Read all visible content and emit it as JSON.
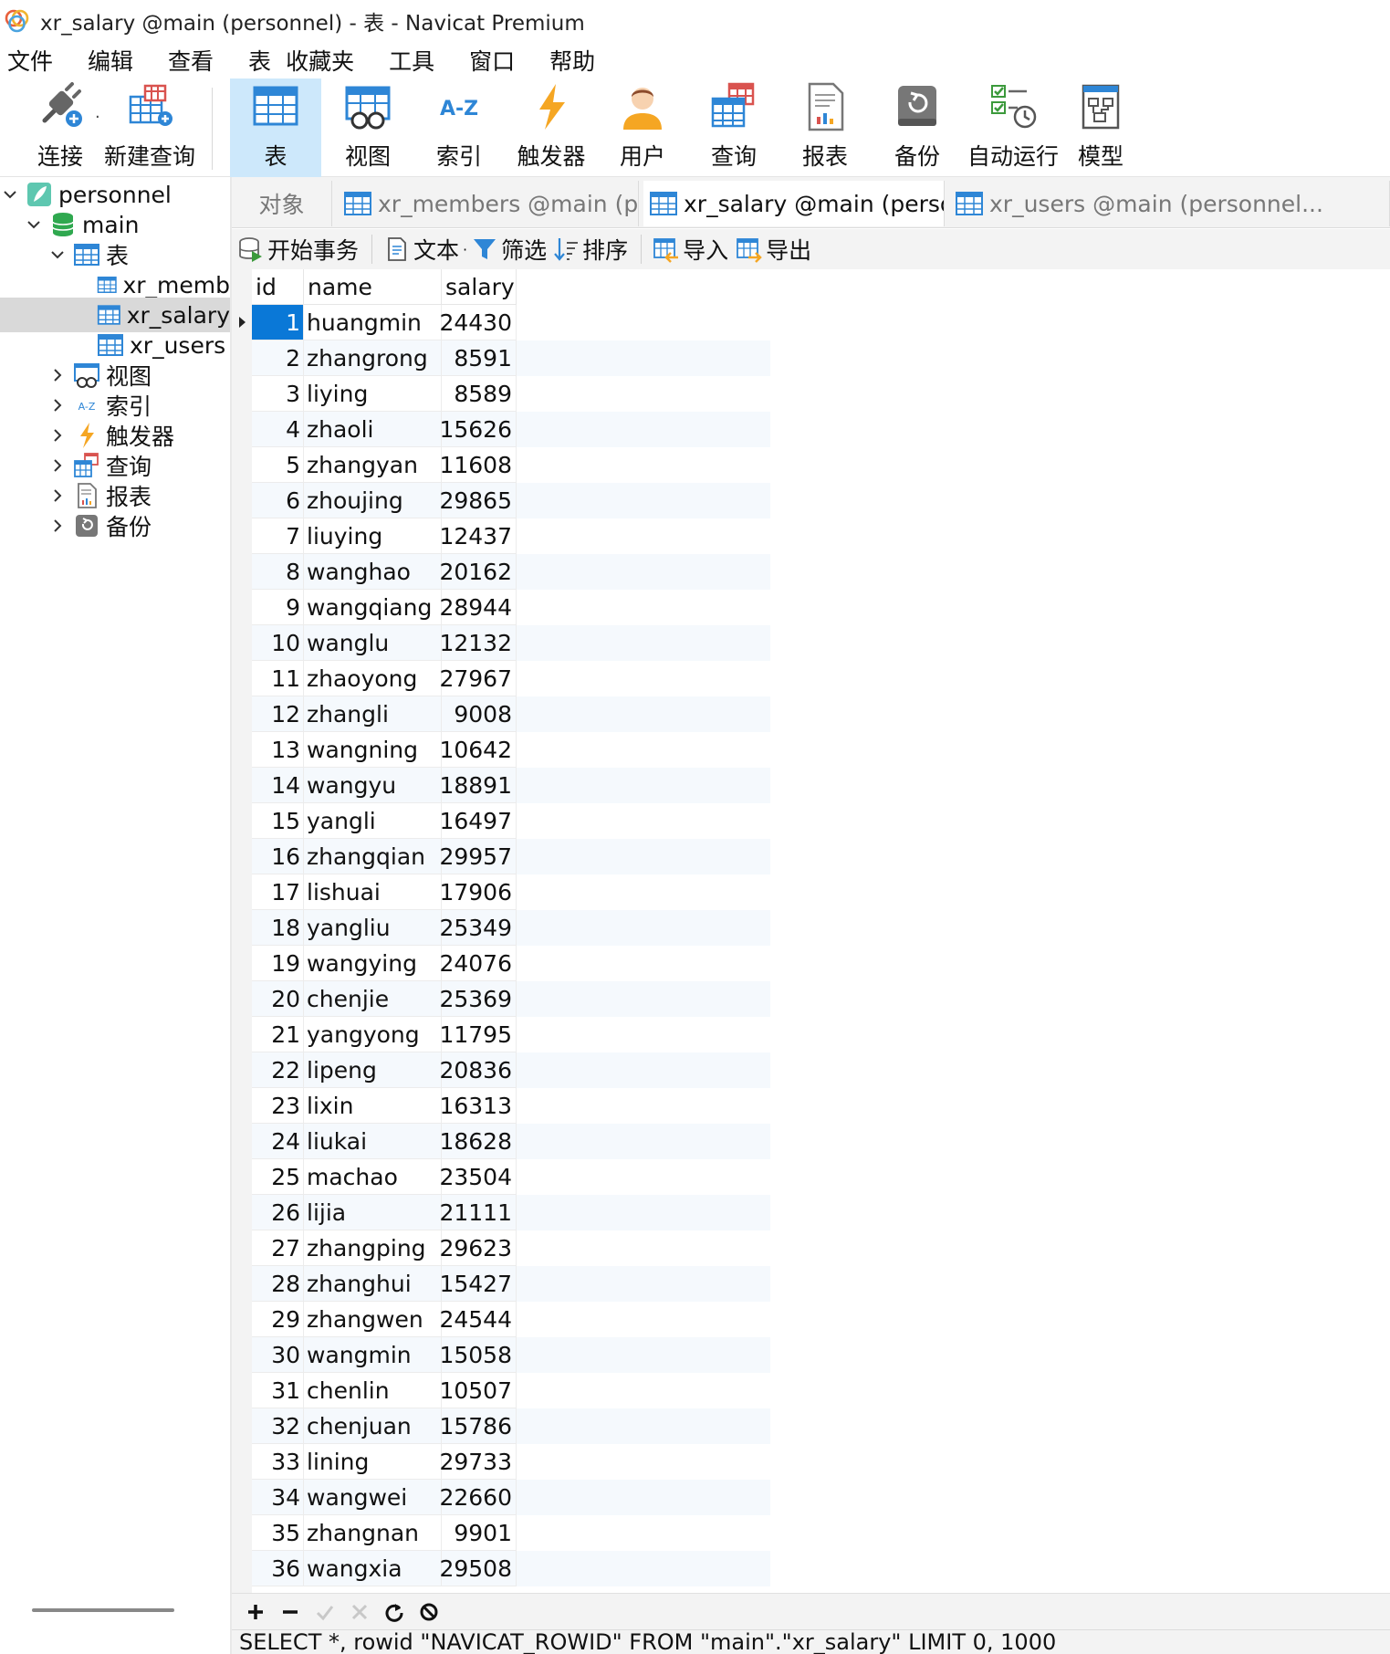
{
  "window": {
    "title": "xr_salary @main (personnel) - 表 - Navicat Premium"
  },
  "menu": [
    "文件",
    "编辑",
    "查看",
    "表",
    "收藏夹",
    "工具",
    "窗口",
    "帮助"
  ],
  "toolbar": {
    "connect": "连接",
    "new_query": "新建查询",
    "table": "表",
    "view": "视图",
    "index": "索引",
    "trigger": "触发器",
    "user": "用户",
    "query": "查询",
    "report": "报表",
    "backup": "备份",
    "automation": "自动运行",
    "model": "模型",
    "active": "表"
  },
  "sidebar": {
    "connection": "personnel",
    "database": "main",
    "tables_label": "表",
    "tables": [
      "xr_memb",
      "xr_salary",
      "xr_users"
    ],
    "selected_table": "xr_salary",
    "groups": [
      "视图",
      "索引",
      "触发器",
      "查询",
      "报表",
      "备份"
    ]
  },
  "tabs": {
    "objects": "对象",
    "items": [
      "xr_members @main (perso...",
      "xr_salary @main (personne...",
      "xr_users @main (personnel..."
    ],
    "active_index": 1
  },
  "subtoolbar": {
    "begin_transaction": "开始事务",
    "text": "文本",
    "filter": "筛选",
    "sort": "排序",
    "import": "导入",
    "export": "导出"
  },
  "grid": {
    "columns": [
      "id",
      "name",
      "salary"
    ],
    "rows": [
      [
        "1",
        "huangmin",
        "24430"
      ],
      [
        "2",
        "zhangrong",
        "8591"
      ],
      [
        "3",
        "liying",
        "8589"
      ],
      [
        "4",
        "zhaoli",
        "15626"
      ],
      [
        "5",
        "zhangyan",
        "11608"
      ],
      [
        "6",
        "zhoujing",
        "29865"
      ],
      [
        "7",
        "liuying",
        "12437"
      ],
      [
        "8",
        "wanghao",
        "20162"
      ],
      [
        "9",
        "wangqiang",
        "28944"
      ],
      [
        "10",
        "wanglu",
        "12132"
      ],
      [
        "11",
        "zhaoyong",
        "27967"
      ],
      [
        "12",
        "zhangli",
        "9008"
      ],
      [
        "13",
        "wangning",
        "10642"
      ],
      [
        "14",
        "wangyu",
        "18891"
      ],
      [
        "15",
        "yangli",
        "16497"
      ],
      [
        "16",
        "zhangqian",
        "29957"
      ],
      [
        "17",
        "lishuai",
        "17906"
      ],
      [
        "18",
        "yangliu",
        "25349"
      ],
      [
        "19",
        "wangying",
        "24076"
      ],
      [
        "20",
        "chenjie",
        "25369"
      ],
      [
        "21",
        "yangyong",
        "11795"
      ],
      [
        "22",
        "lipeng",
        "20836"
      ],
      [
        "23",
        "lixin",
        "16313"
      ],
      [
        "24",
        "liukai",
        "18628"
      ],
      [
        "25",
        "machao",
        "23504"
      ],
      [
        "26",
        "lijia",
        "21111"
      ],
      [
        "27",
        "zhangping",
        "29623"
      ],
      [
        "28",
        "zhanghui",
        "15427"
      ],
      [
        "29",
        "zhangwen",
        "24544"
      ],
      [
        "30",
        "wangmin",
        "15058"
      ],
      [
        "31",
        "chenlin",
        "10507"
      ],
      [
        "32",
        "chenjuan",
        "15786"
      ],
      [
        "33",
        "lining",
        "29733"
      ],
      [
        "34",
        "wangwei",
        "22660"
      ],
      [
        "35",
        "zhangnan",
        "9901"
      ],
      [
        "36",
        "wangxia",
        "29508"
      ]
    ],
    "selected_row": 0
  },
  "status": {
    "sql": "SELECT *, rowid \"NAVICAT_ROWID\" FROM \"main\".\"xr_salary\" LIMIT 0, 1000"
  },
  "colors": {
    "accent": "#0a78d7",
    "active_tool": "#cde8fb",
    "selected_tree": "#d9d9d9"
  }
}
